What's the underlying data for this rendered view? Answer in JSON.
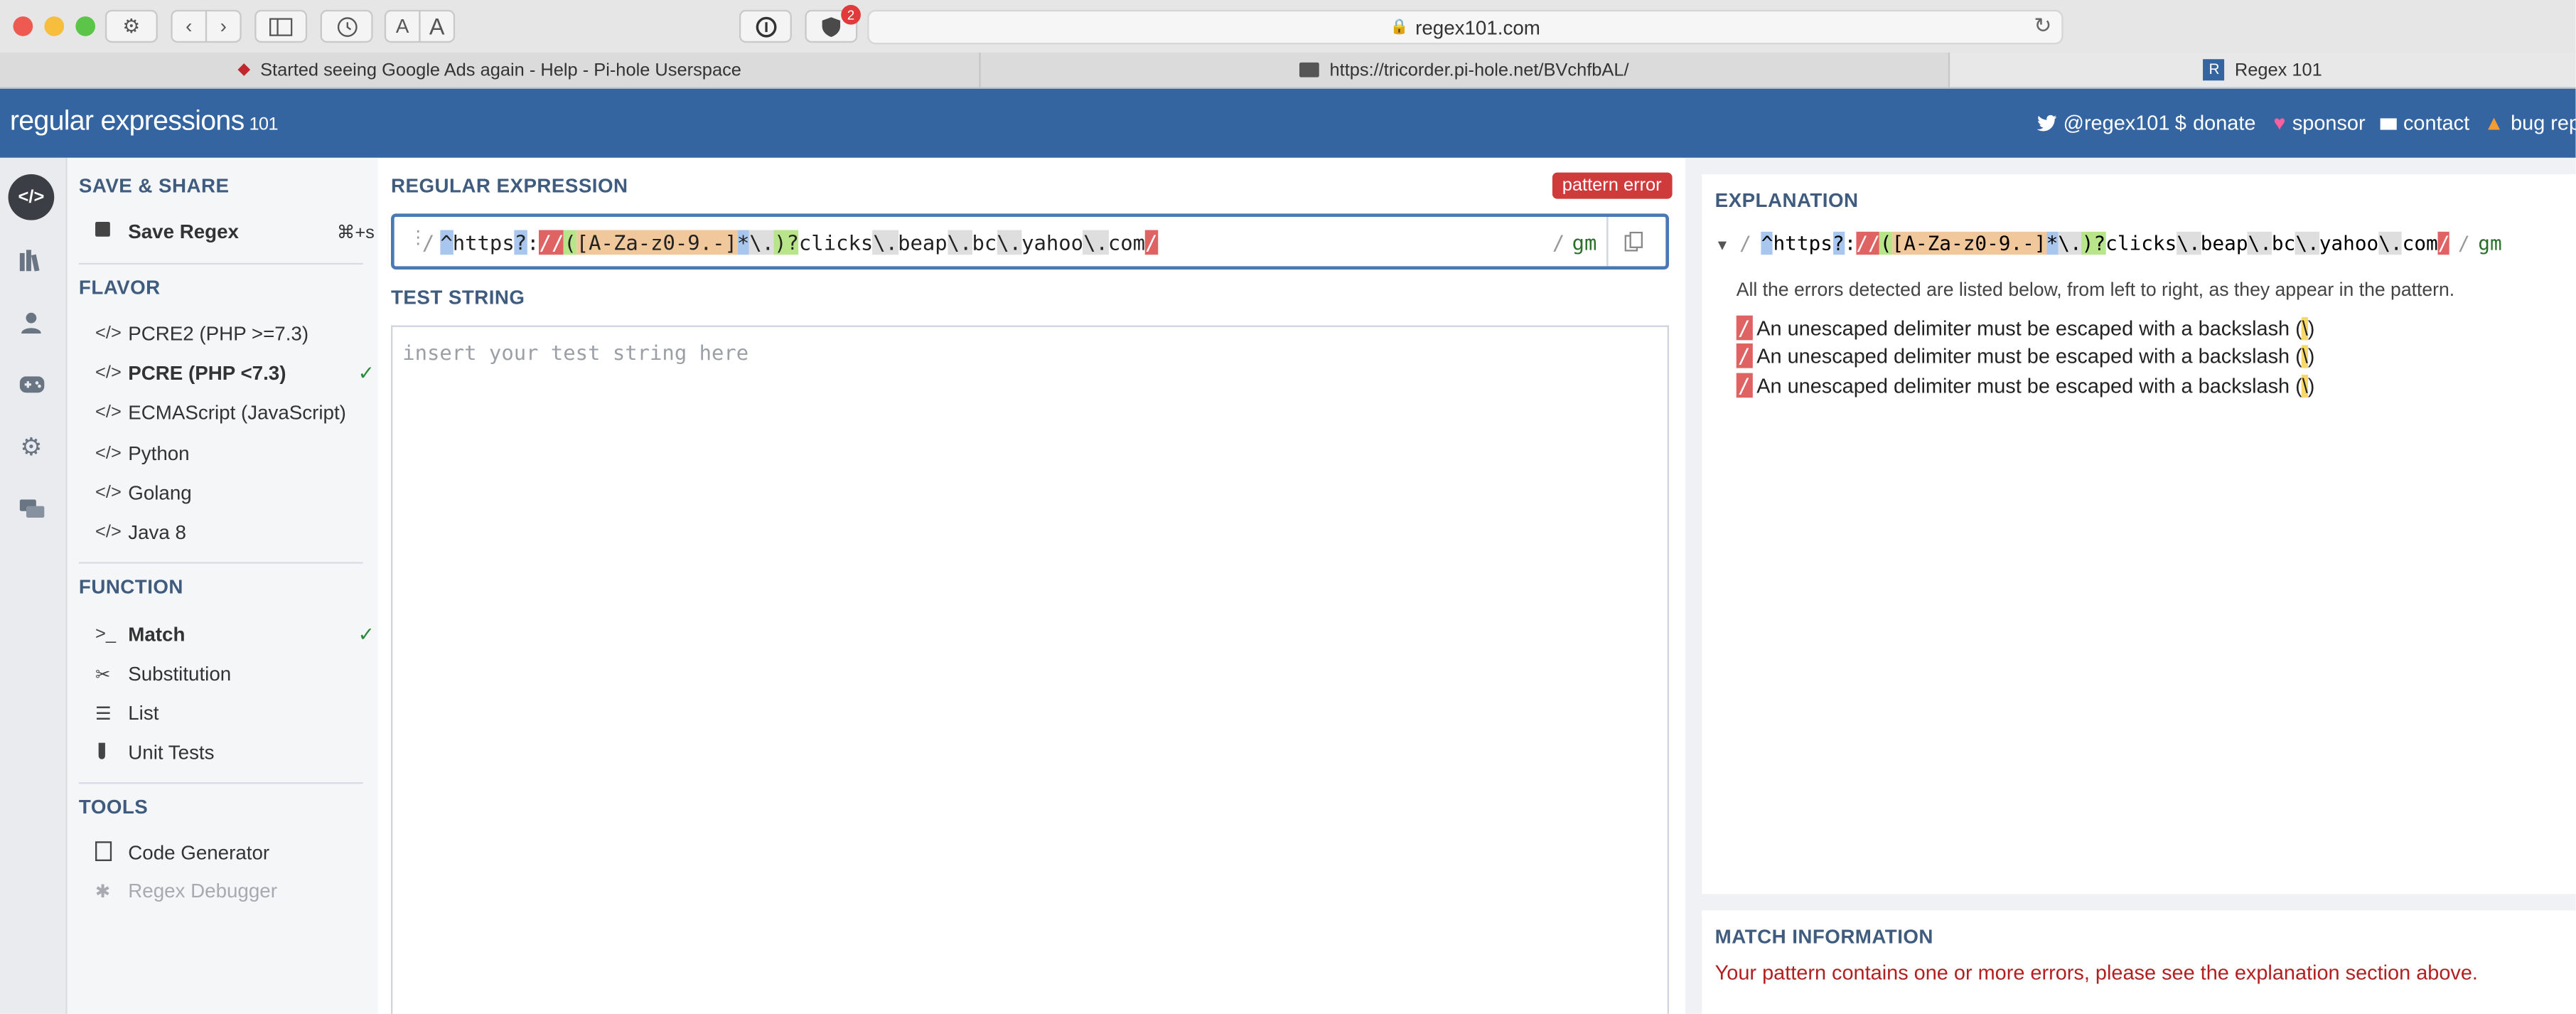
{
  "browser": {
    "url": "regex101.com",
    "notification_count": "2",
    "text_size_small": "A",
    "text_size_large": "A",
    "tabs": [
      {
        "label": "Started seeing Google Ads again - Help - Pi-hole Userspace"
      },
      {
        "label": "https://tricorder.pi-hole.net/BVchfbAL/"
      },
      {
        "label": "Regex 101"
      }
    ],
    "regex_tab_badge": "R"
  },
  "header": {
    "logo_text": "regular expressions",
    "logo_version": "101",
    "links": {
      "twitter": "@regex101",
      "donate": "donate",
      "sponsor": "sponsor",
      "contact": "contact",
      "bug": "bug rep"
    }
  },
  "sidebar": {
    "save_share": {
      "heading": "SAVE & SHARE",
      "save_label": "Save Regex",
      "save_shortcut": "⌘+s"
    },
    "flavor": {
      "heading": "FLAVOR",
      "items": [
        {
          "label": "PCRE2 (PHP >=7.3)"
        },
        {
          "label": "PCRE (PHP <7.3)"
        },
        {
          "label": "ECMAScript (JavaScript)"
        },
        {
          "label": "Python"
        },
        {
          "label": "Golang"
        },
        {
          "label": "Java 8"
        }
      ]
    },
    "function": {
      "heading": "FUNCTION",
      "items": [
        {
          "label": "Match"
        },
        {
          "label": "Substitution"
        },
        {
          "label": "List"
        },
        {
          "label": "Unit Tests"
        }
      ]
    },
    "tools": {
      "heading": "TOOLS",
      "items": [
        {
          "label": "Code Generator"
        },
        {
          "label": "Regex Debugger"
        }
      ]
    }
  },
  "main": {
    "regex_heading": "REGULAR EXPRESSION",
    "error_badge": "pattern error",
    "delimiter_open": "/",
    "delimiter_close": "/",
    "flags": "gm",
    "pattern_tokens": [
      "^",
      "https",
      "?",
      ":",
      "//",
      "(",
      "[A-Za-z0-9.-]",
      "*",
      "\\.",
      ")",
      "?",
      "clicks",
      "\\.",
      "beap",
      "\\.",
      "bc",
      "\\.",
      "yahoo",
      "\\.",
      "com",
      "/"
    ],
    "test_heading": "TEST STRING",
    "test_placeholder": "insert your test string here"
  },
  "explanation": {
    "heading": "EXPLANATION",
    "intro": "All the errors detected are listed below, from left to right, as they appear in the pattern.",
    "error_glyph": "/",
    "error_msg": "An unescaped delimiter must be escaped with a backslash (",
    "error_backslash": "\\",
    "error_close": ")",
    "error_count": 3
  },
  "match_info": {
    "heading": "MATCH INFORMATION",
    "message": "Your pattern contains one or more errors, please see the explanation section above."
  },
  "colors": {
    "header_blue": "#3565a0",
    "error_red": "#cf3b3b",
    "match_error_text": "#b21f1f",
    "check_green": "#2c8a3c"
  }
}
